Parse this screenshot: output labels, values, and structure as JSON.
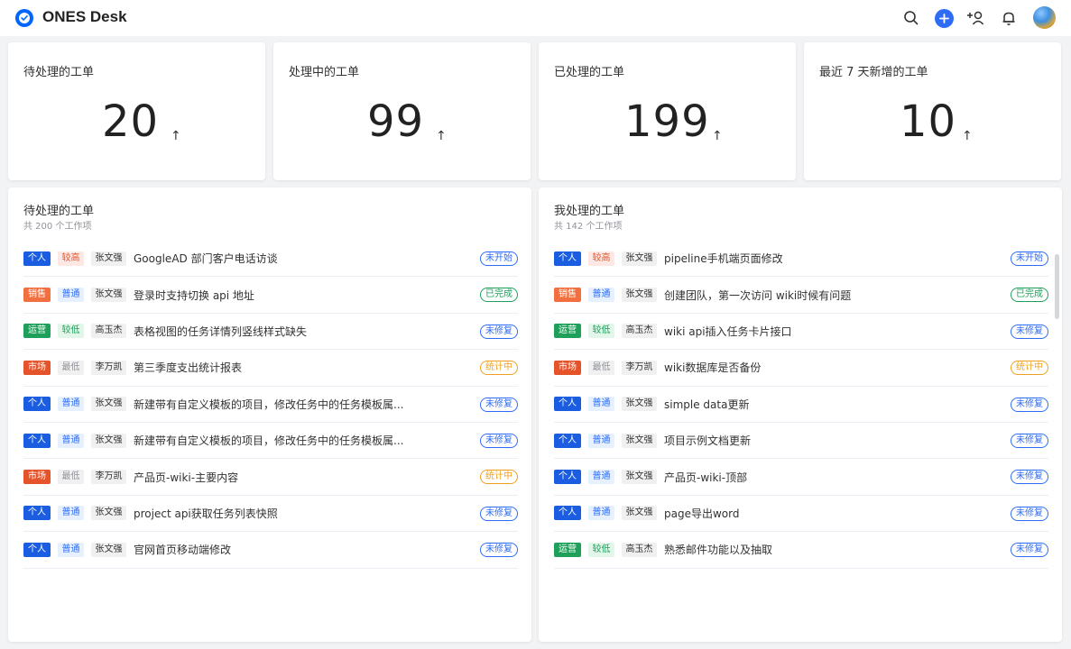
{
  "app": {
    "title": "ONES Desk"
  },
  "header": {
    "icons": [
      "search-icon",
      "add-icon",
      "add-user-icon",
      "bell-icon",
      "avatar"
    ]
  },
  "stats": [
    {
      "title": "待处理的工单",
      "value": "20",
      "arrow": "↑"
    },
    {
      "title": "处理中的工单",
      "value": "99",
      "arrow": "↑"
    },
    {
      "title": "已处理的工单",
      "value": "199",
      "arrow": "↑"
    },
    {
      "title": "最近 7 天新增的工单",
      "value": "10",
      "arrow": "↑"
    }
  ],
  "colors": {
    "个人": "#1a5de0",
    "销售": "#f2703f",
    "运营": "#1ea05a",
    "市场": "#e5532a",
    "较高": {
      "bg": "#fde8e4",
      "fg": "#e5532a"
    },
    "普通": {
      "bg": "#e6f0ff",
      "fg": "#2f6cf6"
    },
    "较低": {
      "bg": "#e3f6ea",
      "fg": "#1ea05a"
    },
    "最低": {
      "bg": "#f0f0f0",
      "fg": "#909399"
    },
    "未开始": "#2f6cf6",
    "已完成": "#1ea05a",
    "未修复": "#2f6cf6",
    "统计中": "#f0a020"
  },
  "panels": [
    {
      "title": "待处理的工单",
      "subtitle": "共 200 个工作项",
      "rows": [
        {
          "cat": "个人",
          "pri": "较高",
          "user": "张文强",
          "title": "GoogleAD 部门客户电话访谈",
          "status": "未开始"
        },
        {
          "cat": "销售",
          "pri": "普通",
          "user": "张文强",
          "title": "登录时支持切换 api 地址",
          "status": "已完成"
        },
        {
          "cat": "运营",
          "pri": "较低",
          "user": "高玉杰",
          "title": "表格视图的任务详情列竖线样式缺失",
          "status": "未修复"
        },
        {
          "cat": "市场",
          "pri": "最低",
          "user": "李万凯",
          "title": "第三季度支出统计报表",
          "status": "统计中"
        },
        {
          "cat": "个人",
          "pri": "普通",
          "user": "张文强",
          "title": "新建带有自定义模板的项目，修改任务中的任务模板属...",
          "status": "未修复"
        },
        {
          "cat": "个人",
          "pri": "普通",
          "user": "张文强",
          "title": "新建带有自定义模板的项目，修改任务中的任务模板属...",
          "status": "未修复"
        },
        {
          "cat": "市场",
          "pri": "最低",
          "user": "李万凯",
          "title": "产品页-wiki-主要内容",
          "status": "统计中"
        },
        {
          "cat": "个人",
          "pri": "普通",
          "user": "张文强",
          "title": "project api获取任务列表快照",
          "status": "未修复"
        },
        {
          "cat": "个人",
          "pri": "普通",
          "user": "张文强",
          "title": "官网首页移动端修改",
          "status": "未修复"
        }
      ]
    },
    {
      "title": "我处理的工单",
      "subtitle": "共 142 个工作项",
      "rows": [
        {
          "cat": "个人",
          "pri": "较高",
          "user": "张文强",
          "title": "pipeline手机端页面修改",
          "status": "未开始"
        },
        {
          "cat": "销售",
          "pri": "普通",
          "user": "张文强",
          "title": "创建团队，第一次访问 wiki时候有问题",
          "status": "已完成"
        },
        {
          "cat": "运营",
          "pri": "较低",
          "user": "高玉杰",
          "title": "wiki api插入任务卡片接口",
          "status": "未修复"
        },
        {
          "cat": "市场",
          "pri": "最低",
          "user": "李万凯",
          "title": "wiki数据库是否备份",
          "status": "统计中"
        },
        {
          "cat": "个人",
          "pri": "普通",
          "user": "张文强",
          "title": "simple data更新",
          "status": "未修复"
        },
        {
          "cat": "个人",
          "pri": "普通",
          "user": "张文强",
          "title": "项目示例文档更新",
          "status": "未修复"
        },
        {
          "cat": "个人",
          "pri": "普通",
          "user": "张文强",
          "title": "产品页-wiki-顶部",
          "status": "未修复"
        },
        {
          "cat": "个人",
          "pri": "普通",
          "user": "张文强",
          "title": "page导出word",
          "status": "未修复"
        },
        {
          "cat": "运营",
          "pri": "较低",
          "user": "高玉杰",
          "title": "熟悉邮件功能以及抽取",
          "status": "未修复"
        }
      ]
    }
  ]
}
